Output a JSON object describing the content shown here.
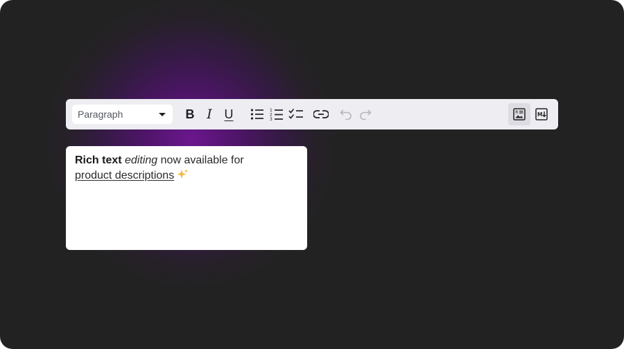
{
  "toolbar": {
    "block_type": {
      "selected": "Paragraph"
    },
    "buttons": {
      "bold": "B",
      "italic": "I",
      "underline": "U"
    },
    "icons": {
      "bullet_list": "bullet-list-icon",
      "numbered_list": "numbered-list-icon",
      "checklist": "checklist-icon",
      "link": "link-icon",
      "undo": "undo-icon",
      "redo": "redo-icon",
      "rich_text_mode": "rich-text-mode-icon",
      "markdown_mode": "markdown-icon"
    },
    "active_mode": "rich-text"
  },
  "editor": {
    "bold_text": "Rich text",
    "italic_text": "editing",
    "plain_text": "now available for",
    "underlined_text": "product descriptions"
  },
  "colors": {
    "background": "#222222",
    "glow": "#6c168f",
    "toolbar_bg": "#ededf2",
    "sparkle": "#f4b63c"
  }
}
